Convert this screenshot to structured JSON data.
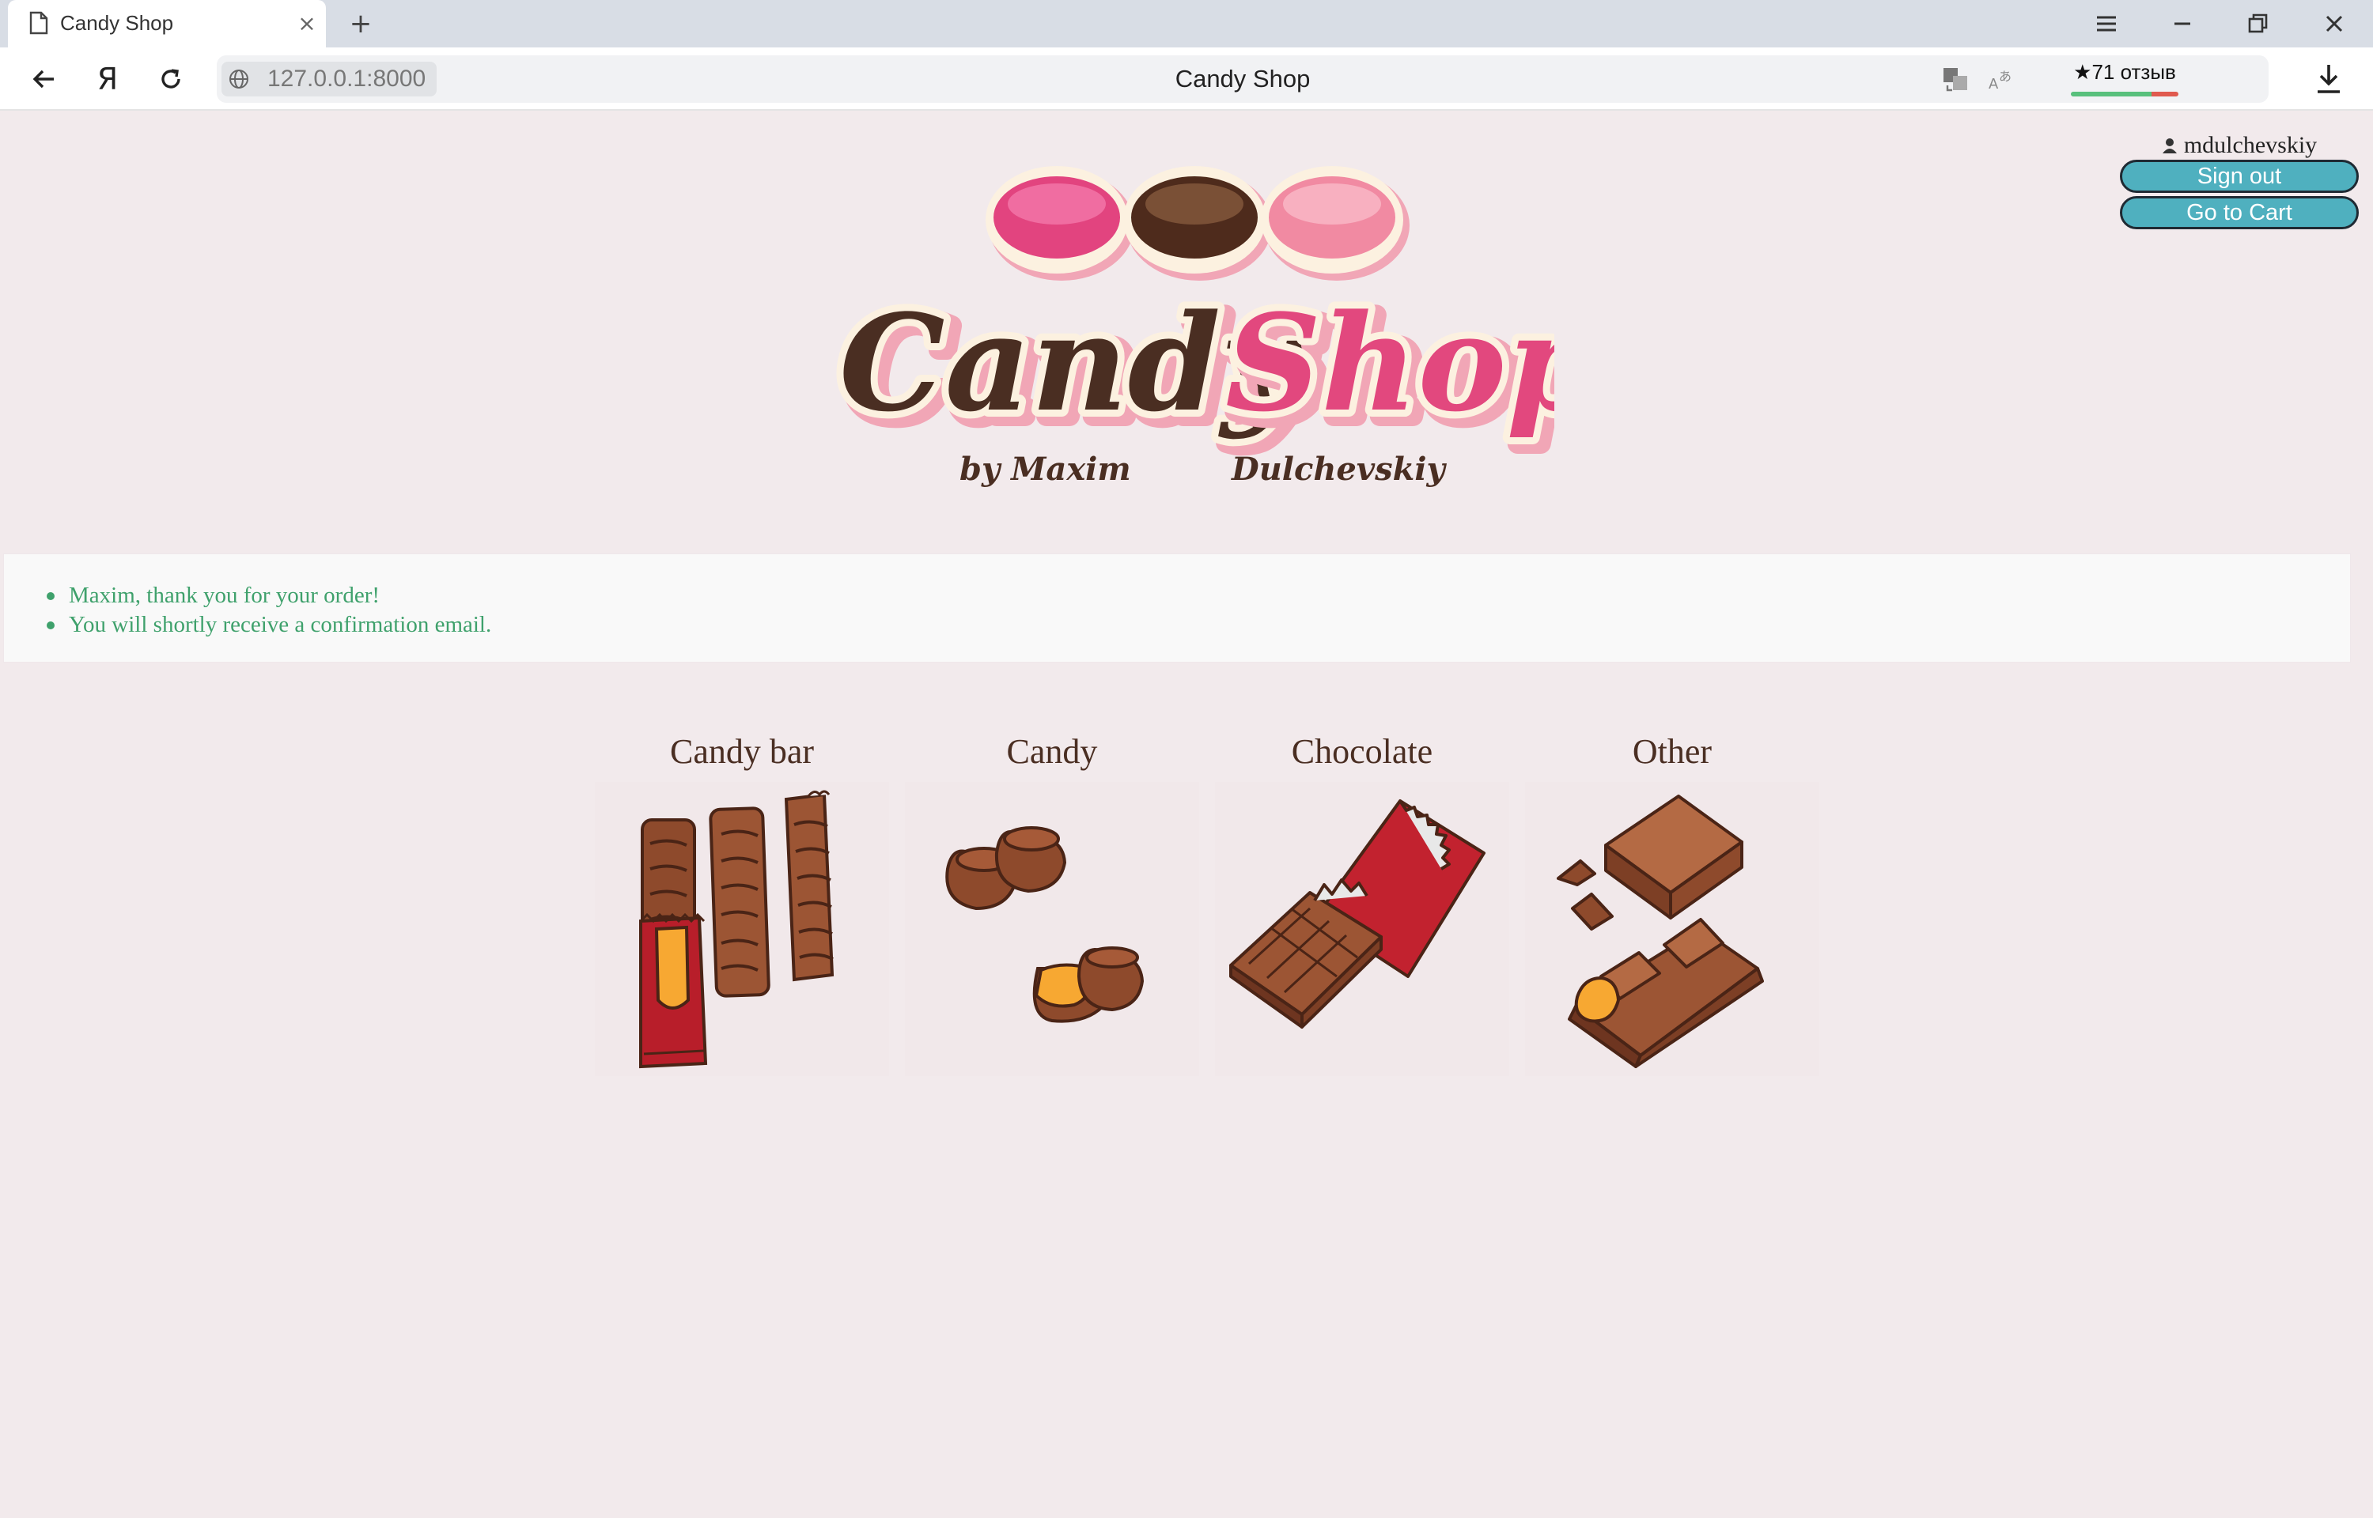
{
  "browser": {
    "tab_title": "Candy Shop",
    "address_url": "127.0.0.1:8000",
    "page_title": "Candy Shop",
    "reviews_label": "★71 отзыв"
  },
  "header": {
    "username": "mdulchevskiy",
    "sign_out_label": "Sign out",
    "go_to_cart_label": "Go to Cart"
  },
  "logo": {
    "word_1": "Candy",
    "word_2": "Shop",
    "byline_1": "by  Maxim",
    "byline_2": "Dulchevskiy"
  },
  "messages": [
    "Maxim, thank you for your order!",
    "You will shortly receive a confirmation email."
  ],
  "categories": [
    {
      "label": "Candy bar",
      "icon": "candy-bar-icon"
    },
    {
      "label": "Candy",
      "icon": "candy-icon"
    },
    {
      "label": "Chocolate",
      "icon": "chocolate-icon"
    },
    {
      "label": "Other",
      "icon": "other-sweets-icon"
    }
  ],
  "colors": {
    "page_background": "#f2eaec",
    "button": "#4fb0bf",
    "message_text": "#3fa16c",
    "brown": "#4a2e22",
    "pink": "#e2487e"
  }
}
